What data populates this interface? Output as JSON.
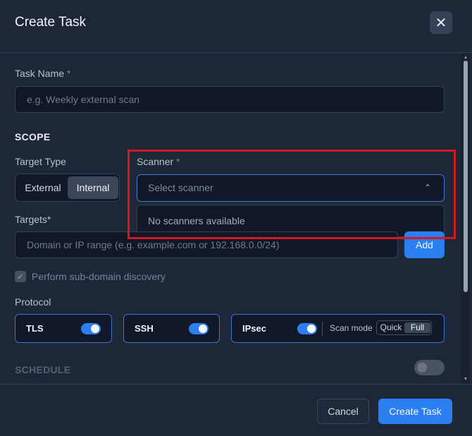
{
  "dialog": {
    "title": "Create Task",
    "close_icon": "close-icon"
  },
  "task_name": {
    "label": "Task Name",
    "required_marker": "*",
    "placeholder": "e.g. Weekly external scan"
  },
  "scope": {
    "title": "SCOPE",
    "target_type": {
      "label": "Target Type",
      "options": [
        "External",
        "Internal"
      ],
      "selected": "Internal"
    },
    "scanner": {
      "label": "Scanner",
      "required_marker": "*",
      "placeholder": "Select scanner",
      "empty_message": "No scanners available",
      "chevron_icon": "chevron-up-icon"
    },
    "targets": {
      "label": "Targets*",
      "placeholder": "Domain or IP range (e.g. example.com or 192.168.0.0/24)",
      "add_label": "Add"
    },
    "subdomain_discovery": {
      "label": "Perform sub-domain discovery",
      "checked": true,
      "disabled": true
    }
  },
  "protocol": {
    "label": "Protocol",
    "items": [
      {
        "name": "TLS",
        "enabled": true
      },
      {
        "name": "SSH",
        "enabled": true
      },
      {
        "name": "IPsec",
        "enabled": true,
        "scan_mode_label": "Scan mode",
        "modes": [
          "Quick",
          "Full"
        ],
        "selected_mode": "Full"
      }
    ]
  },
  "schedule": {
    "label": "SCHEDULE",
    "enabled": false
  },
  "footer": {
    "cancel_label": "Cancel",
    "create_label": "Create Task"
  },
  "colors": {
    "accent": "#2b7ff0",
    "highlight": "#d51922"
  }
}
